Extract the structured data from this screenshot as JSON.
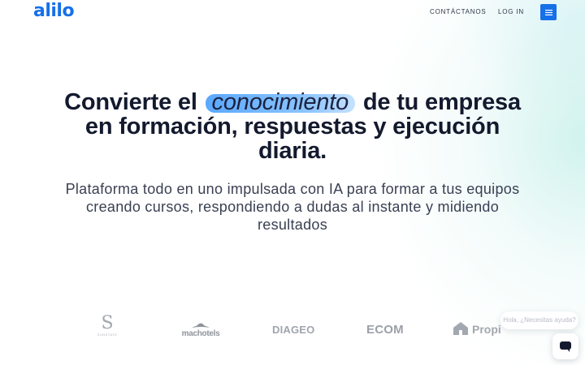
{
  "header": {
    "logo": "alilo",
    "nav": {
      "contact": "CONTÁCTANOS",
      "login": "LOG IN"
    },
    "menu_icon": "hamburger-menu-icon"
  },
  "hero": {
    "headline_before": "Convierte el",
    "headline_highlight": "conocimiento",
    "headline_after": "de tu empresa en formación, respuestas y ejecución diaria.",
    "subtitle": "Plataforma todo en uno impulsada con IA para formar a tus equipos creando cursos, respondiendo a dudas al instante y midiendo resultados"
  },
  "logos": {
    "s_brand": {
      "mark": "S",
      "caption": "SUNSTATE"
    },
    "mac_hotels": "machotels",
    "diageo": "DIAGEO",
    "ecom": "ECOM",
    "propi": "Propi"
  },
  "chat": {
    "bubble_text": "Hola, ¿Necesitas ayuda?",
    "button_icon": "chat-icon"
  },
  "colors": {
    "brand": "#1670e8",
    "highlight": "#5aa8ff",
    "text": "#141a2e"
  }
}
